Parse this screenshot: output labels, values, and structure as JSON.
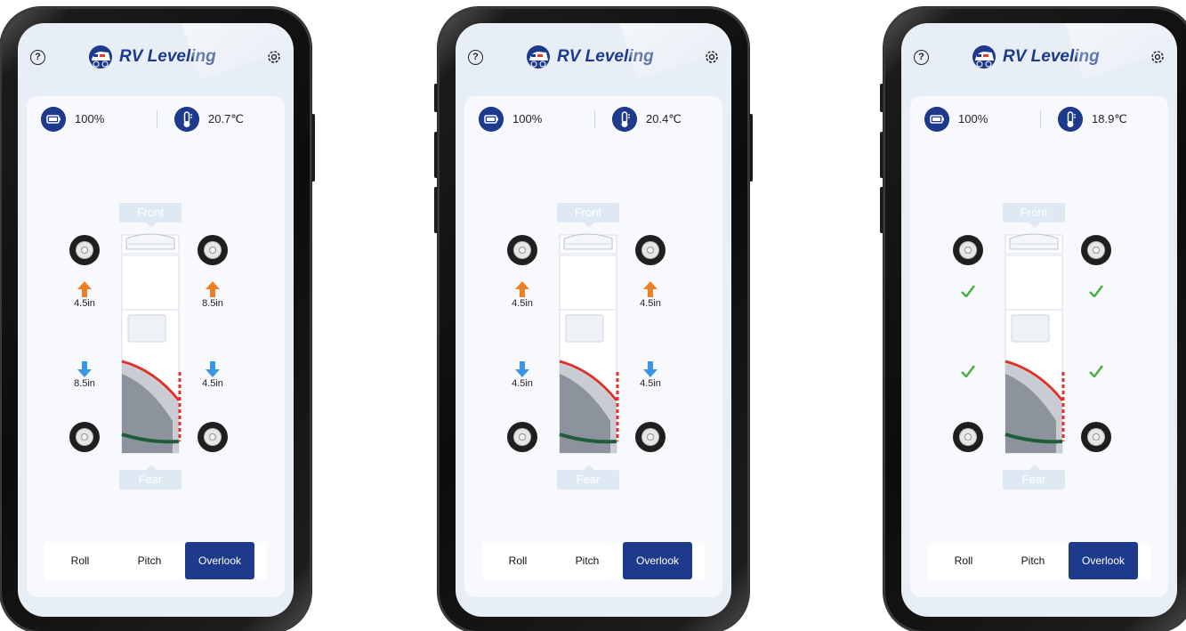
{
  "app": {
    "title": "RV Leveling",
    "brand_color": "#1d3a8c",
    "raise_color": "#f07e22",
    "lower_color": "#3b97e3",
    "level_color": "#4caf50"
  },
  "icons": {
    "help": "help-circle-icon",
    "settings": "gear-icon",
    "battery": "battery-icon",
    "temperature": "thermometer-icon",
    "raise": "arrow-up-icon",
    "lower": "arrow-down-icon",
    "level": "check-icon"
  },
  "labels": {
    "help_glyph": "?",
    "front": "Front",
    "rear": "Fear"
  },
  "tabs": [
    {
      "label": "Roll",
      "selected": false
    },
    {
      "label": "Pitch",
      "selected": false
    },
    {
      "label": "Overlook",
      "selected": true
    }
  ],
  "screens": [
    {
      "battery": "100%",
      "temperature": "20.7℃",
      "wheels": {
        "front_left": {
          "state": "raise",
          "value": "4.5in"
        },
        "front_right": {
          "state": "raise",
          "value": "8.5in"
        },
        "rear_left": {
          "state": "lower",
          "value": "8.5in"
        },
        "rear_right": {
          "state": "lower",
          "value": "4.5in"
        }
      }
    },
    {
      "battery": "100%",
      "temperature": "20.4℃",
      "wheels": {
        "front_left": {
          "state": "raise",
          "value": "4.5in"
        },
        "front_right": {
          "state": "raise",
          "value": "4.5in"
        },
        "rear_left": {
          "state": "lower",
          "value": "4.5in"
        },
        "rear_right": {
          "state": "lower",
          "value": "4.5in"
        }
      }
    },
    {
      "battery": "100%",
      "temperature": "18.9℃",
      "wheels": {
        "front_left": {
          "state": "level",
          "value": ""
        },
        "front_right": {
          "state": "level",
          "value": ""
        },
        "rear_left": {
          "state": "level",
          "value": ""
        },
        "rear_right": {
          "state": "level",
          "value": ""
        }
      }
    }
  ]
}
